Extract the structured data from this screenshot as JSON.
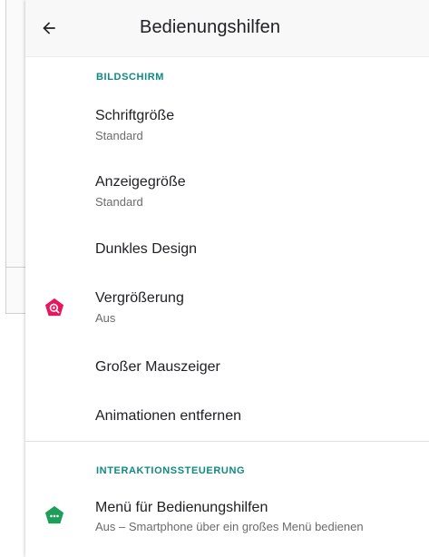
{
  "header": {
    "title": "Bedienungshilfen",
    "back_icon": "arrow-back-icon"
  },
  "sections": [
    {
      "header": "BILDSCHIRM",
      "items": [
        {
          "title": "Schriftgröße",
          "subtitle": "Standard"
        },
        {
          "title": "Anzeigegröße",
          "subtitle": "Standard"
        },
        {
          "title": "Dunkles Design"
        },
        {
          "title": "Vergrößerung",
          "subtitle": "Aus",
          "icon": "magnification-icon",
          "icon_color": "#e8175d"
        },
        {
          "title": "Großer Mauszeiger"
        },
        {
          "title": "Animationen entfernen"
        }
      ]
    },
    {
      "header": "INTERAKTIONSSTEUERUNG",
      "items": [
        {
          "title": "Menü für Bedienungshilfen",
          "subtitle": "Aus – Smartphone über ein großes Menü bedienen",
          "icon": "accessibility-menu-icon",
          "icon_color": "#1e9e58"
        }
      ]
    }
  ],
  "colors": {
    "accent": "#0f8a80",
    "appbar_bg": "#f8f8f8"
  }
}
